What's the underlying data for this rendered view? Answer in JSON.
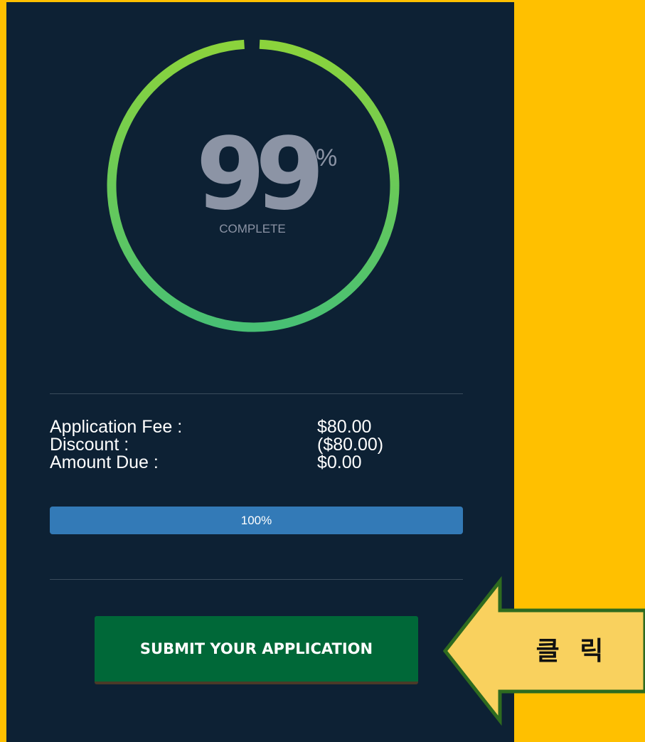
{
  "progress_ring": {
    "value": 99,
    "number_text": "99",
    "percent_symbol": "%",
    "caption": "COMPLETE",
    "colors": {
      "start": "#8BD33C",
      "end": "#48C074",
      "track": "#0D2134"
    }
  },
  "fees": [
    {
      "label": "Application Fee :",
      "value": "$80.00"
    },
    {
      "label": "Discount :",
      "value": "($80.00)"
    },
    {
      "label": "Amount Due :",
      "value": "$0.00"
    }
  ],
  "progress_bar": {
    "value_percent": 100,
    "label": "100%",
    "color": "#337AB7"
  },
  "submit": {
    "label": "SUBMIT YOUR APPLICATION",
    "color": "#006838"
  },
  "callout": {
    "label": "클 릭",
    "fill": "#F9D15E",
    "stroke": "#2E6B1F"
  },
  "colors": {
    "background": "#FFC000",
    "panel": "#0D2134",
    "muted_text": "#8C94A5"
  }
}
